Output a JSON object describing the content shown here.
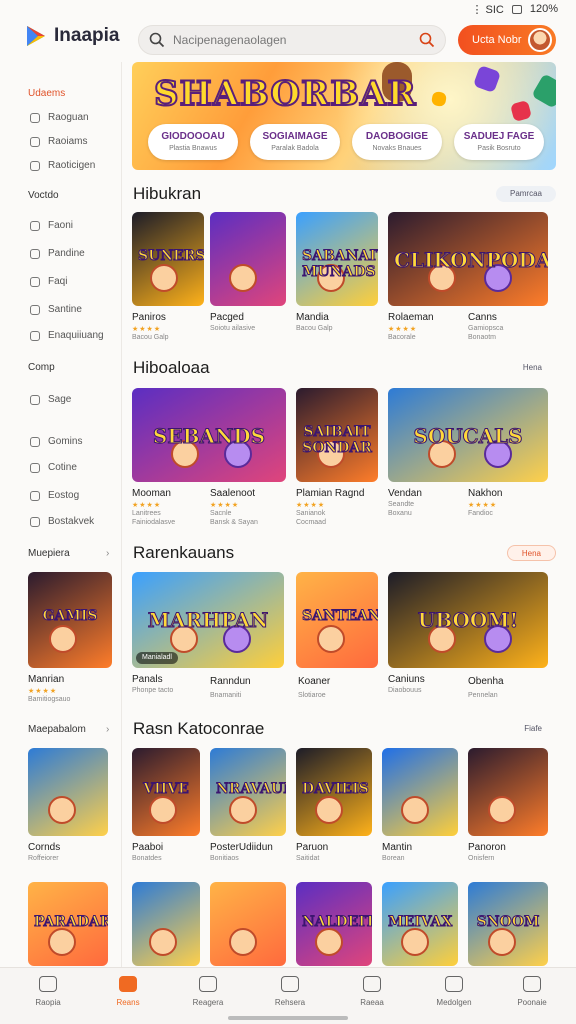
{
  "status": {
    "text": "⋮ SIC",
    "battery": "120%"
  },
  "app": {
    "name": "Inaapia"
  },
  "search": {
    "placeholder": "Nacipenagenaolagen"
  },
  "header": {
    "cta_label": "Ucta Nobr"
  },
  "banner": {
    "title": "SHABORBAR",
    "pills": [
      {
        "title": "GIODOOOAU",
        "sub": "Plastia Bnawus"
      },
      {
        "title": "SOGIAIMAGE",
        "sub": "Paralak Badola"
      },
      {
        "title": "DAOBOGIGE",
        "sub": "Novaks Bnaues"
      },
      {
        "title": "SADUEJ FAGE",
        "sub": "Pasik Bosruto"
      }
    ]
  },
  "sidebar": {
    "items": [
      {
        "label": "Udaems",
        "kind": "heading-orange"
      },
      {
        "label": "Raoguan",
        "kind": "item"
      },
      {
        "label": "Raoiams",
        "kind": "item"
      },
      {
        "label": "Raoticigen",
        "kind": "item"
      },
      {
        "label": "Voctdo",
        "kind": "heading"
      },
      {
        "label": "Faoni",
        "kind": "item"
      },
      {
        "label": "Pandine",
        "kind": "item"
      },
      {
        "label": "Faqi",
        "kind": "item"
      },
      {
        "label": "Santine",
        "kind": "item"
      },
      {
        "label": "Enaquiiuang",
        "kind": "item"
      },
      {
        "label": "Comp",
        "kind": "heading"
      },
      {
        "label": "Sage",
        "kind": "item"
      },
      {
        "label": "Gomins",
        "kind": "item"
      },
      {
        "label": "Cotine",
        "kind": "item"
      },
      {
        "label": "Eostog",
        "kind": "item"
      },
      {
        "label": "Bostakvek",
        "kind": "item"
      },
      {
        "label": "Muepiera",
        "kind": "heading"
      },
      {
        "label": "Maepabalom",
        "kind": "heading"
      }
    ]
  },
  "sections": [
    {
      "title": "Hibukran",
      "button": "Pamrcaa"
    },
    {
      "title": "Hiboaloaa",
      "button": "Hena"
    },
    {
      "title": "Rarenkauans",
      "button": "Hena"
    },
    {
      "title": "Rasn Katoconrae",
      "button": "Fiafe"
    }
  ],
  "row1": [
    {
      "art": "SUNERS",
      "name": "Paniros",
      "sub1": "Bacou Galp",
      "sub2": ""
    },
    {
      "art": "",
      "name": "Pacged",
      "sub1": "Soiotu ailasive",
      "sub2": ""
    },
    {
      "art": "SABANAIT MUNADS",
      "name": "Mandia",
      "sub1": "Bacou Galp",
      "sub2": ""
    },
    {
      "art": "CLIKONPODAS",
      "name": "Rolaeman",
      "sub1": "Bacorale",
      "sub2": ""
    },
    {
      "art": "",
      "name": "Canns",
      "sub1": "Gamiopsca",
      "sub2": "Bonaotm"
    }
  ],
  "row2": [
    {
      "art": "SEBANDS",
      "name": "Mooman",
      "sub1": "Lanitrees",
      "sub2": "Fainiodalasve"
    },
    {
      "art": "",
      "name": "Saalenoot",
      "sub1": "Sacnle",
      "sub2": "Bansk & Sayan"
    },
    {
      "art": "SAIBAIT SONDAR",
      "name": "Plamian Ragnd",
      "sub1": "Sanianok",
      "sub2": "Cocmaad"
    },
    {
      "art": "SOUCALS",
      "name": "Vendan",
      "sub1": "Seandte",
      "sub2": "Boxanu"
    },
    {
      "art": "",
      "name": "Nakhon",
      "sub1": "Fandioc",
      "sub2": ""
    }
  ],
  "row3": [
    {
      "art": "GAMIS",
      "name": "Manrian",
      "sub1": "Bamitiogsauo",
      "sub2": ""
    },
    {
      "art": "MARHPAN",
      "name": "Panals",
      "sub1": "Phonpe tacto",
      "sub2": "",
      "tag": "Manialadl"
    },
    {
      "art": "SANTEAN",
      "name": "Ranndun",
      "sub1": "Bnamaniti",
      "sub2": ""
    },
    {
      "art": "",
      "name": "Koaner",
      "sub1": "Slotiaroe",
      "sub2": ""
    },
    {
      "art": "UBOOM!",
      "name": "Caniuns",
      "sub1": "Diaobouus",
      "sub2": ""
    },
    {
      "art": "",
      "name": "Obenha",
      "sub1": "Pennelan",
      "sub2": ""
    }
  ],
  "row4": [
    {
      "art": "",
      "name": "Cornds",
      "sub1": "Roffeiorer",
      "sub2": ""
    },
    {
      "art": "VIIVE",
      "name": "Paaboi",
      "sub1": "Bonatdes",
      "sub2": ""
    },
    {
      "art": "NRAVAUN",
      "name": "PosterUdiidun",
      "sub1": "Bonitiaos",
      "sub2": ""
    },
    {
      "art": "DAVIEIS",
      "name": "Paruon",
      "sub1": "Saitidat",
      "sub2": ""
    },
    {
      "art": "",
      "name": "Mantin",
      "sub1": "Borean",
      "sub2": ""
    },
    {
      "art": "",
      "name": "Panoron",
      "sub1": "Onisfern",
      "sub2": ""
    }
  ],
  "row5": [
    {
      "art": "PARADAR"
    },
    {
      "art": ""
    },
    {
      "art": ""
    },
    {
      "art": "NALDEIT"
    },
    {
      "art": "MEIVAX"
    },
    {
      "art": "SNOOM"
    }
  ],
  "nav": [
    {
      "label": "Raopia",
      "active": false
    },
    {
      "label": "Reans",
      "active": true
    },
    {
      "label": "Reagera",
      "active": false
    },
    {
      "label": "Rehsera",
      "active": false
    },
    {
      "label": "Raeaa",
      "active": false
    },
    {
      "label": "Medolgen",
      "active": false
    },
    {
      "label": "Poonaie",
      "active": false
    }
  ],
  "colors": {
    "accent": "#f06a22",
    "purple": "#5a1f7a"
  }
}
